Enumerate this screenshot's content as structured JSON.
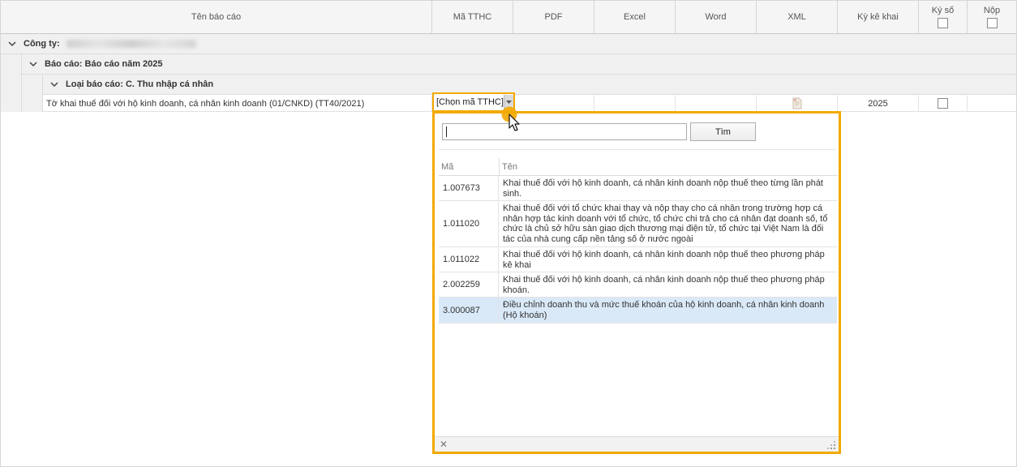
{
  "columns": {
    "report_name": "Tên báo cáo",
    "ma_tthc": "Mã TTHC",
    "pdf": "PDF",
    "excel": "Excel",
    "word": "Word",
    "xml": "XML",
    "period": "Kỳ kê khai",
    "signed": "Ký số",
    "submit": "Nộp"
  },
  "groups": {
    "company_label": "Công ty:",
    "report_group": "Báo cáo: Báo cáo năm 2025",
    "type_group": "Loại báo cáo: C. Thu nhập cá nhân"
  },
  "row": {
    "name": "Tờ khai thuế đối với hộ kinh doanh, cá nhân kinh doanh (01/CNKD) (TT40/2021)",
    "ma_tthc_value": "[Chọn mã TTHC]",
    "period": "2025"
  },
  "popup": {
    "search_value": "",
    "search_button": "Tìm",
    "col_code": "Mã",
    "col_name": "Tên",
    "items": [
      {
        "code": "1.007673",
        "name": "Khai thuế đối với hộ kinh doanh, cá nhân kinh doanh nộp thuế theo từng lần phát sinh."
      },
      {
        "code": "1.011020",
        "name": "Khai thuế đối với tổ chức khai thay và nộp thay cho cá nhân trong trường hợp cá nhân hợp tác kinh doanh với tổ chức, tổ chức chi trả cho cá nhân đạt doanh số, tổ chức là chủ sở hữu sàn giao dịch thương mại điện tử, tổ chức tại Việt Nam là đối tác của nhà cung cấp nền tảng số ở nước ngoài"
      },
      {
        "code": "1.011022",
        "name": "Khai thuế đối với hộ kinh doanh, cá nhân kinh doanh nộp thuế theo phương pháp kê khai"
      },
      {
        "code": "2.002259",
        "name": "Khai thuế đối với hộ kinh doanh, cá nhân kinh doanh nộp thuế theo phương pháp khoán."
      },
      {
        "code": "3.000087",
        "name": "Điều chỉnh doanh thu và mức thuế khoán của hộ kinh doanh, cá nhân kinh doanh (Hộ khoán)"
      }
    ],
    "selected_index": 4
  },
  "colors": {
    "highlight": "#f2a900",
    "selection": "#d9e9f8"
  }
}
